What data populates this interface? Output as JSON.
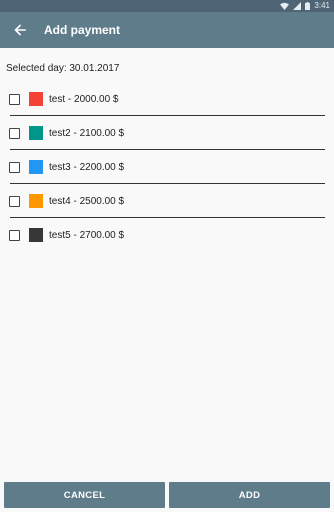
{
  "status_bar": {
    "time": "3:41"
  },
  "app_bar": {
    "title": "Add payment"
  },
  "selected_day": "Selected day: 30.01.2017",
  "payments": [
    {
      "label": "test - 2000.00 $",
      "color": "#f34336",
      "checked": false
    },
    {
      "label": "test2 - 2100.00 $",
      "color": "#009688",
      "checked": false
    },
    {
      "label": "test3 - 2200.00 $",
      "color": "#2196f3",
      "checked": false
    },
    {
      "label": "test4 - 2500.00 $",
      "color": "#ff9800",
      "checked": false
    },
    {
      "label": "test5 - 2700.00 $",
      "color": "#373737",
      "checked": false
    }
  ],
  "buttons": {
    "cancel": "CANCEL",
    "add": "ADD"
  }
}
